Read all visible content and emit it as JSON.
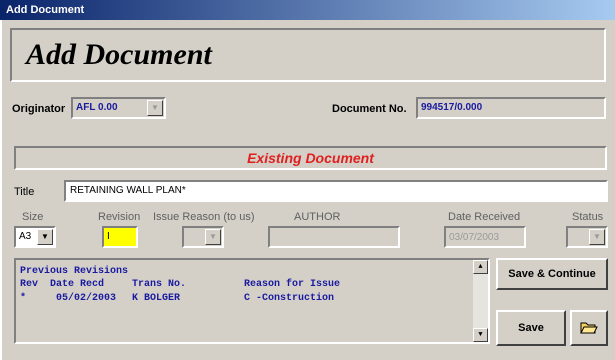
{
  "window": {
    "title": "Add Document"
  },
  "header": {
    "title": "Add Document"
  },
  "originator": {
    "label": "Originator",
    "value": "AFL 0.00"
  },
  "document_no": {
    "label": "Document No.",
    "value": "994517/0.000"
  },
  "status_banner": "Existing Document",
  "title_field": {
    "label": "Title",
    "value": "RETAINING WALL PLAN*"
  },
  "fields": {
    "size_label": "Size",
    "size_value": "A3",
    "revision_label": "Revision",
    "revision_value": "I",
    "issue_reason_label": "Issue Reason (to us)",
    "author_label": "AUTHOR",
    "date_received_label": "Date Received",
    "date_received_value": "03/07/2003",
    "status_label": "Status"
  },
  "revisions": {
    "heading": "Previous Revisions",
    "columns": [
      "Rev",
      "Date Recd",
      "Trans No.",
      "Reason for Issue"
    ],
    "rows": [
      {
        "rev": "*",
        "date": "05/02/2003",
        "trans": "K BOLGER",
        "reason": "C -Construction"
      }
    ]
  },
  "buttons": {
    "save_continue": "Save & Continue",
    "save": "Save",
    "folder_icon": "folder-open-icon"
  },
  "colors": {
    "title_bar_start": "#0a246a",
    "banner_text": "#e02020",
    "highlight_field": "#ffff00",
    "list_text": "#1a1aa0"
  }
}
